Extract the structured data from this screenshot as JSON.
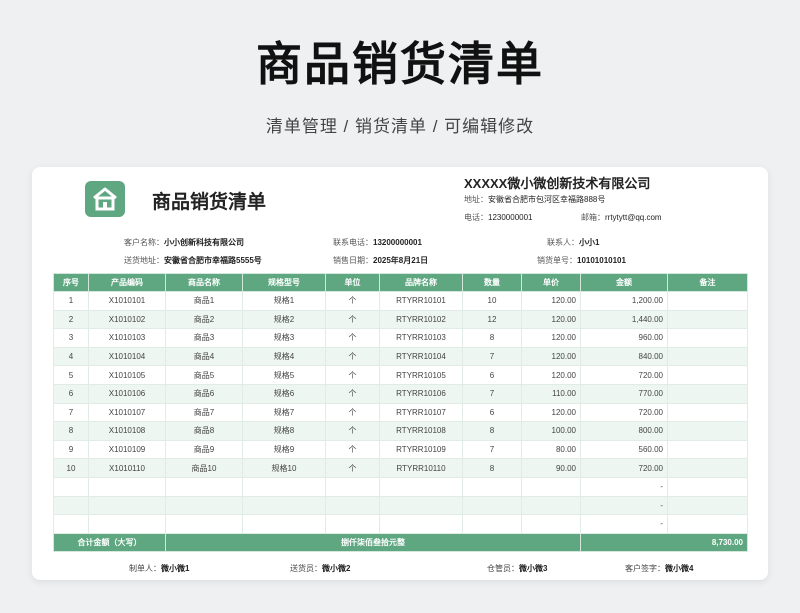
{
  "page": {
    "title": "商品销货清单",
    "subtitle": "清单管理 / 销货清单 / 可编辑修改"
  },
  "doc": {
    "title": "商品销货清单",
    "company": "XXXXX微小微创新技术有限公司",
    "address_label": "地址：",
    "address": "安徽省合肥市包河区幸福路888号",
    "phone_label": "电话：",
    "phone": "1230000001",
    "email_label": "邮箱：",
    "email": "rrtytytt@qq.com"
  },
  "info": {
    "customer_label": "客户名称：",
    "customer": "小小创新科技有限公司",
    "contact_phone_label": "联系电话：",
    "contact_phone": "13200000001",
    "contact_label": "联系人：",
    "contact": "小小1",
    "ship_addr_label": "送货地址：",
    "ship_addr": "安徽省合肥市幸福路5555号",
    "date_label": "销售日期：",
    "date": "2025年8月21日",
    "order_label": "销货单号：",
    "order": "10101010101"
  },
  "table": {
    "headers": [
      "序号",
      "产品编码",
      "商品名称",
      "规格型号",
      "单位",
      "品牌名称",
      "数量",
      "单价",
      "金额",
      "备注"
    ],
    "rows": [
      [
        "1",
        "X1010101",
        "商品1",
        "规格1",
        "个",
        "RTYRR10101",
        "10",
        "120.00",
        "1,200.00",
        ""
      ],
      [
        "2",
        "X1010102",
        "商品2",
        "规格2",
        "个",
        "RTYRR10102",
        "12",
        "120.00",
        "1,440.00",
        ""
      ],
      [
        "3",
        "X1010103",
        "商品3",
        "规格3",
        "个",
        "RTYRR10103",
        "8",
        "120.00",
        "960.00",
        ""
      ],
      [
        "4",
        "X1010104",
        "商品4",
        "规格4",
        "个",
        "RTYRR10104",
        "7",
        "120.00",
        "840.00",
        ""
      ],
      [
        "5",
        "X1010105",
        "商品5",
        "规格5",
        "个",
        "RTYRR10105",
        "6",
        "120.00",
        "720.00",
        ""
      ],
      [
        "6",
        "X1010106",
        "商品6",
        "规格6",
        "个",
        "RTYRR10106",
        "7",
        "110.00",
        "770.00",
        ""
      ],
      [
        "7",
        "X1010107",
        "商品7",
        "规格7",
        "个",
        "RTYRR10107",
        "6",
        "120.00",
        "720.00",
        ""
      ],
      [
        "8",
        "X1010108",
        "商品8",
        "规格8",
        "个",
        "RTYRR10108",
        "8",
        "100.00",
        "800.00",
        ""
      ],
      [
        "9",
        "X1010109",
        "商品9",
        "规格9",
        "个",
        "RTYRR10109",
        "7",
        "80.00",
        "560.00",
        ""
      ],
      [
        "10",
        "X1010110",
        "商品10",
        "规格10",
        "个",
        "RTYRR10110",
        "8",
        "90.00",
        "720.00",
        ""
      ],
      [
        "",
        "",
        "",
        "",
        "",
        "",
        "",
        "",
        "-",
        ""
      ],
      [
        "",
        "",
        "",
        "",
        "",
        "",
        "",
        "",
        "-",
        ""
      ],
      [
        "",
        "",
        "",
        "",
        "",
        "",
        "",
        "",
        "-",
        ""
      ]
    ],
    "total_label": "合计金额（大写）",
    "total_words": "捌仟柒佰叁拾元整",
    "total_amount": "8,730.00"
  },
  "footer": {
    "maker_label": "制单人：",
    "maker": "微小微1",
    "sender_label": "送货员：",
    "sender": "微小微2",
    "warehouse_label": "仓管员：",
    "warehouse": "微小微3",
    "sign_label": "客户签字：",
    "sign": "微小微4"
  },
  "colors": {
    "accent": "#5ea780",
    "stripe": "#eef6f1"
  },
  "icons": {
    "logo": "house-icon"
  }
}
